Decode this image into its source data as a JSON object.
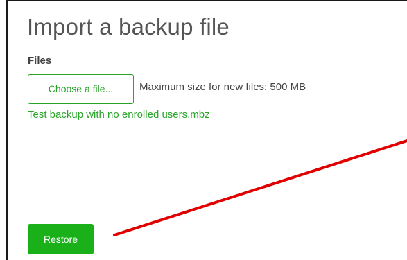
{
  "page": {
    "title": "Import a backup file"
  },
  "files": {
    "label": "Files",
    "choose_button_label": "Choose a file...",
    "max_size_text": "Maximum size for new files: 500 MB",
    "selected_file": "Test backup with no enrolled users.mbz"
  },
  "actions": {
    "restore_label": "Restore"
  },
  "colors": {
    "accent_green": "#27a327",
    "restore_green": "#19b019",
    "annotation_red": "#e00000",
    "title_gray": "#555555"
  },
  "annotation": {
    "type": "arrow-line",
    "color": "red"
  }
}
